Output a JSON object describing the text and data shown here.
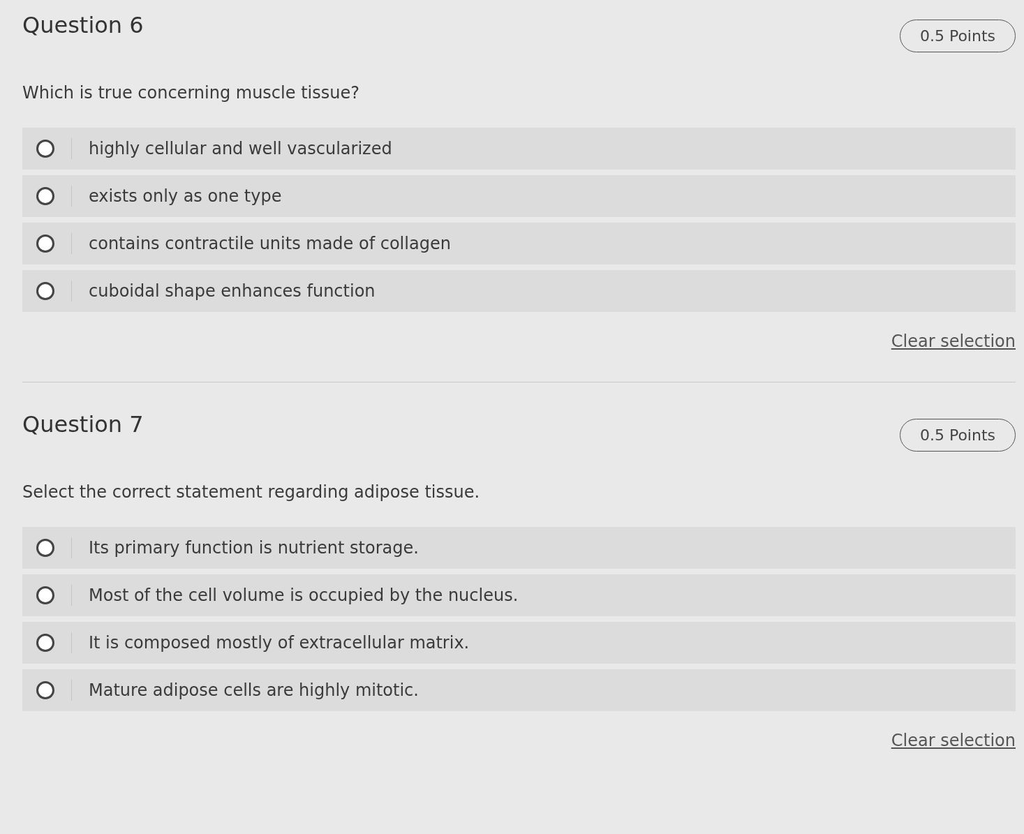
{
  "questions": [
    {
      "title": "Question 6",
      "points": "0.5 Points",
      "prompt": "Which is true concerning muscle tissue?",
      "options": [
        {
          "label": "highly cellular and well vascularized",
          "selected": false
        },
        {
          "label": "exists only as one type",
          "selected": false
        },
        {
          "label": "contains contractile units made of collagen",
          "selected": false
        },
        {
          "label": "cuboidal shape enhances function",
          "selected": false
        }
      ],
      "clear": "Clear selection"
    },
    {
      "title": "Question 7",
      "points": "0.5 Points",
      "prompt": "Select the correct statement regarding adipose tissue.",
      "options": [
        {
          "label": "Its primary function is nutrient storage.",
          "selected": false
        },
        {
          "label": "Most of the cell volume is occupied by the nucleus.",
          "selected": false
        },
        {
          "label": "It is composed mostly of extracellular matrix.",
          "selected": false
        },
        {
          "label": "Mature adipose cells are highly mitotic.",
          "selected": false
        }
      ],
      "clear": "Clear selection"
    }
  ]
}
